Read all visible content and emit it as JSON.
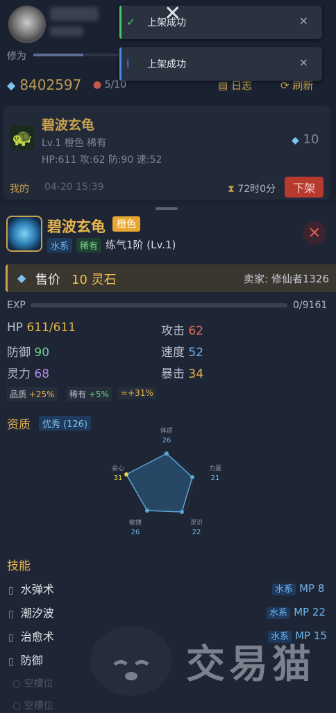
{
  "header": {
    "cultivation_label": "修为",
    "spirit_stones": "8402597",
    "slots": "5/10",
    "log_label": "日志",
    "refresh_label": "刷新"
  },
  "listing_card": {
    "name": "碧波玄龟",
    "level_line": "Lv.1 橙色 稀有",
    "stats_line": "HP:611 攻:62 防:90 速:52",
    "price": "10",
    "owner_label": "我的",
    "time": "04-20 15:39",
    "time_left": "72时0分",
    "delist_label": "下架"
  },
  "toasts": [
    {
      "text": "上架成功",
      "kind": "success",
      "color": "#4cc46a"
    },
    {
      "text": "上架成功",
      "kind": "info",
      "color": "#4a8de0"
    }
  ],
  "detail": {
    "name": "碧波玄龟",
    "quality": "橙色",
    "element": "水系",
    "rarity": "稀有",
    "realm": "练气1阶 (Lv.1)",
    "price_label": "售价",
    "price_value": "10 灵石",
    "seller": "卖家: 修仙者1326",
    "exp_label": "EXP",
    "exp_value": "0/9161",
    "exp_progress": 0,
    "stats": [
      {
        "label": "HP",
        "value": "611/611",
        "color": "#e8b64c"
      },
      {
        "label": "攻击",
        "value": "62",
        "color": "#e06a52"
      },
      {
        "label": "防御",
        "value": "90",
        "color": "#6fd08b"
      },
      {
        "label": "速度",
        "value": "52",
        "color": "#6fb6ee"
      },
      {
        "label": "灵力",
        "value": "68",
        "color": "#b38ce8"
      },
      {
        "label": "暴击",
        "value": "34",
        "color": "#e8b64c"
      }
    ],
    "modifiers": {
      "quality_label": "品质",
      "quality_value": "+25%",
      "rarity_label": "稀有",
      "rarity_value": "+5%",
      "total": "=+31%"
    },
    "aptitude_label": "资质",
    "aptitude_badge": "优秀 (126)",
    "radar": [
      {
        "label": "体质",
        "value": "26"
      },
      {
        "label": "力量",
        "value": "21"
      },
      {
        "label": "灵识",
        "value": "22"
      },
      {
        "label": "敏捷",
        "value": "26"
      },
      {
        "label": "会心",
        "value": "31"
      }
    ],
    "skills_label": "技能",
    "skills": [
      {
        "name": "水弹术",
        "element": "水系",
        "mp": "MP 8"
      },
      {
        "name": "潮汐波",
        "element": "水系",
        "mp": "MP 22"
      },
      {
        "name": "治愈术",
        "element": "水系",
        "mp": "MP 15"
      },
      {
        "name": "防御",
        "element": "",
        "mp": ""
      }
    ],
    "empty_slots": [
      "空槽位",
      "空槽位"
    ]
  },
  "watermark": "交易猫"
}
